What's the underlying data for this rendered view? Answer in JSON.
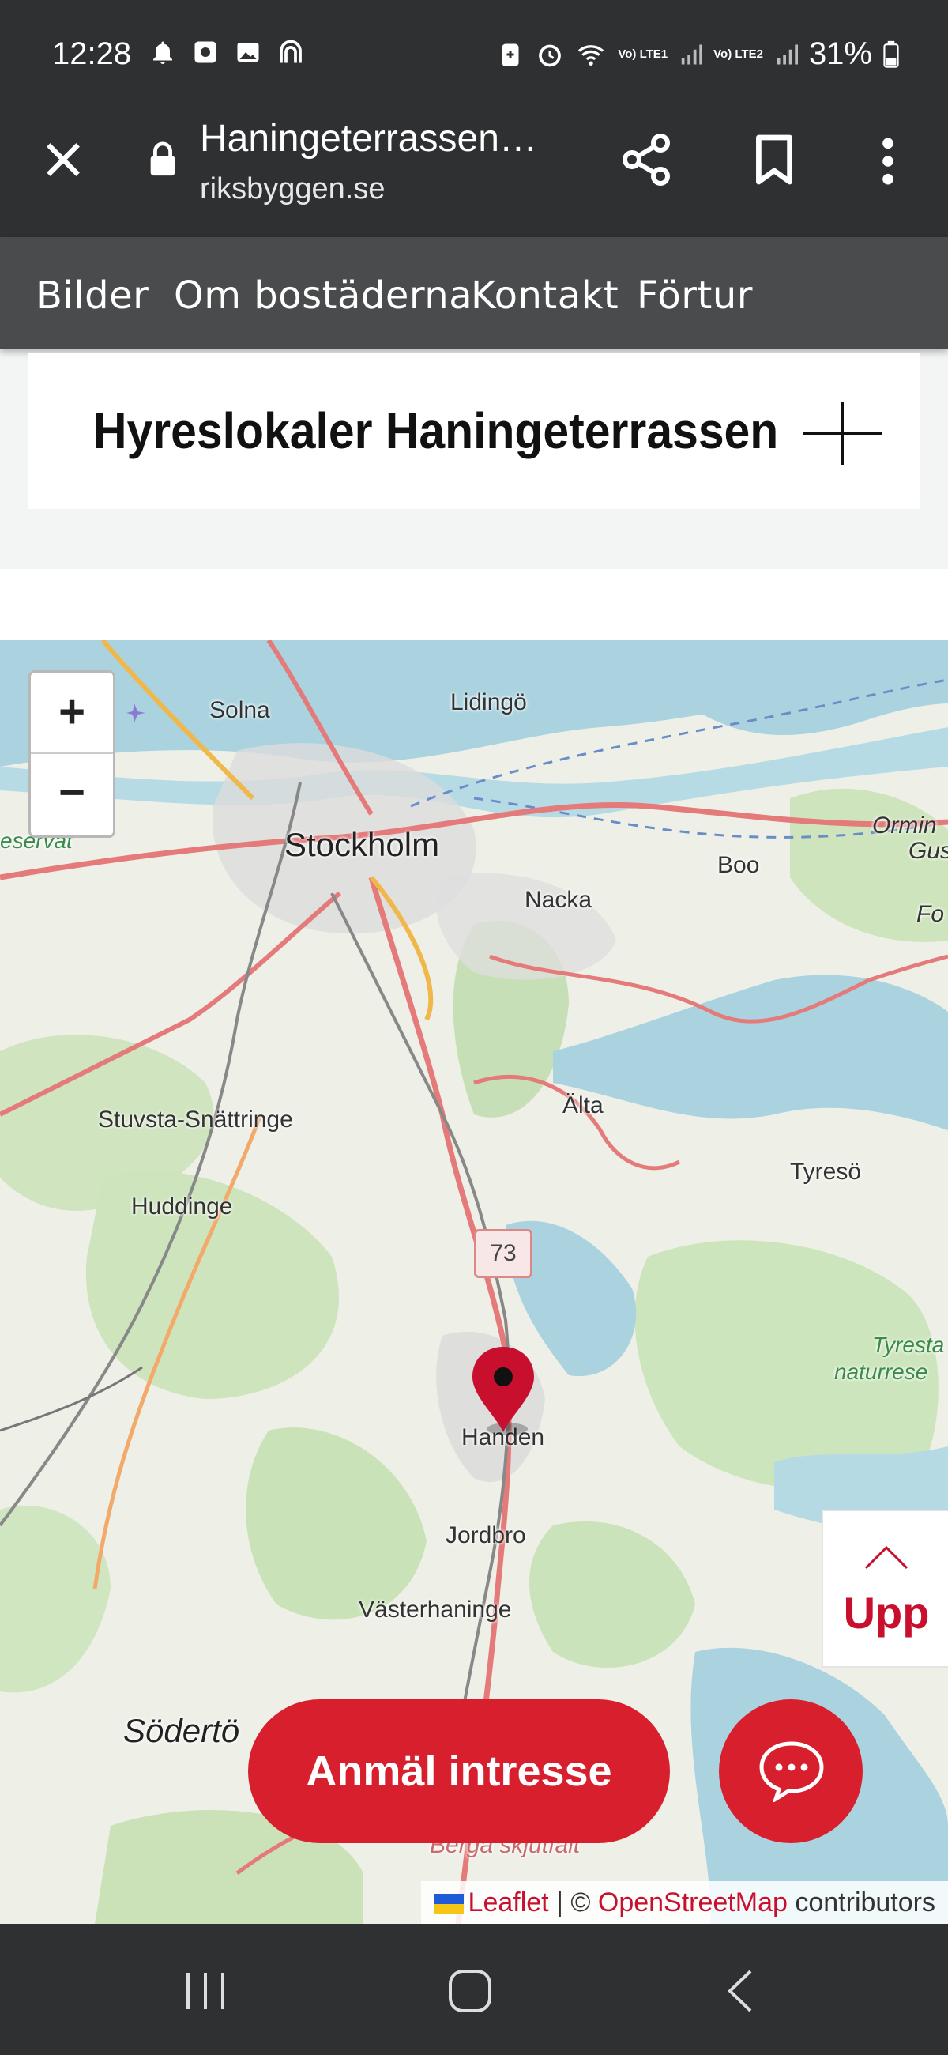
{
  "statusbar": {
    "time": "12:28",
    "battery": "31%",
    "sim1_label": "Vo) LTE1",
    "sim2_label": "Vo) LTE2"
  },
  "browser": {
    "page_title": "Haningeterrassen…",
    "host": "riksbyggen.se"
  },
  "sitenav": {
    "items": [
      {
        "label": "Bilder"
      },
      {
        "label": "Om bostäderna"
      },
      {
        "label": "Kontakt"
      },
      {
        "label": "Förtur"
      }
    ]
  },
  "accordion": {
    "title": "Hyreslokaler Haningeterrassen"
  },
  "map": {
    "zoom_in": "+",
    "zoom_out": "−",
    "road_number": "73",
    "labels": {
      "solna": "Solna",
      "lidingo": "Lidingö",
      "stockholm": "Stockholm",
      "nacka": "Nacka",
      "boo": "Boo",
      "ormin": "Ormin",
      "gus": "Gus",
      "fo": "Fo",
      "eservat": "eservat",
      "stuvsta": "Stuvsta-Snättringe",
      "alta": "Älta",
      "tyreso": "Tyresö",
      "huddinge": "Huddinge",
      "tyreso_natur_1": "Tyresta",
      "tyreso_natur_2": "naturrese",
      "handen": "Handen",
      "jordbro": "Jordbro",
      "vasterhaninge": "Västerhaninge",
      "sodertorn": "Södertö",
      "berga": "Berga skjutfält"
    },
    "attribution": {
      "leaflet": "Leaflet",
      "separator": " | © ",
      "osm": "OpenStreetMap",
      "contributors": " contributors"
    }
  },
  "floating": {
    "upp_label": "Upp",
    "cta_label": "Anmäl intresse"
  },
  "colors": {
    "brand_red": "#d81f2d",
    "link_red": "#c8102e",
    "chrome_dark": "#2f3032",
    "nav_grey": "#4a4b4c"
  }
}
